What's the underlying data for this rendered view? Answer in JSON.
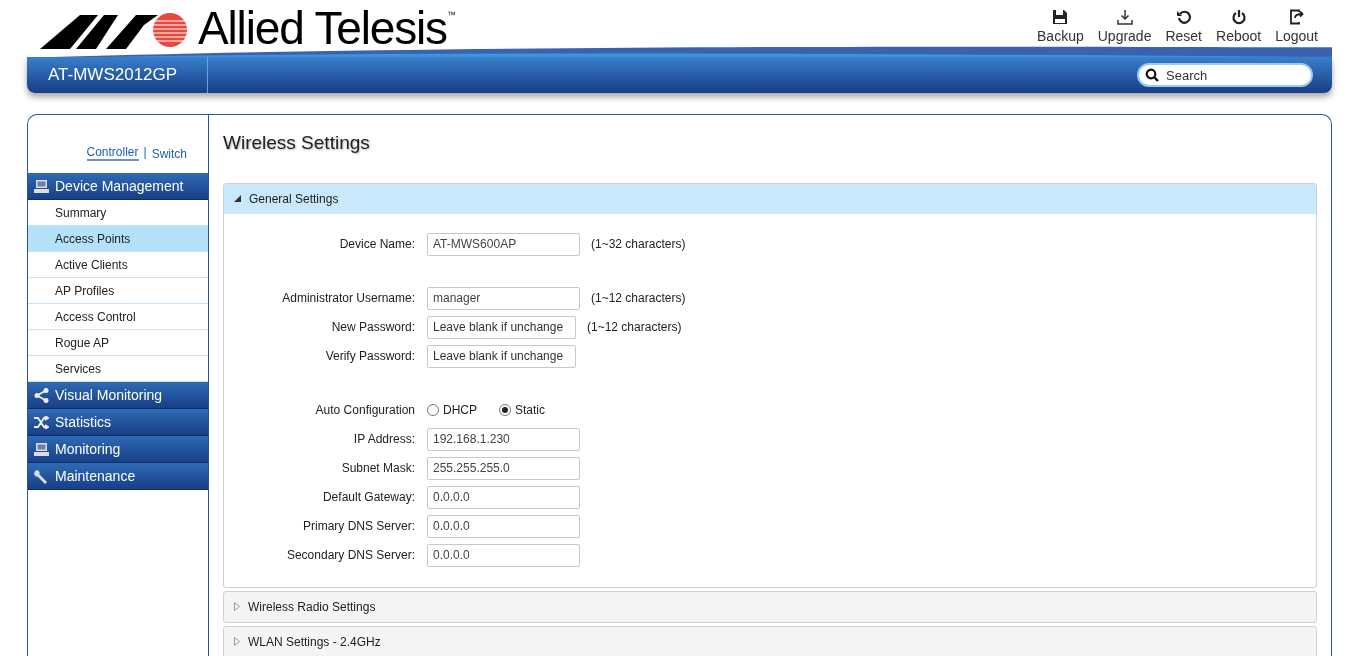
{
  "header": {
    "logo_text": "Allied Telesis",
    "trademark": "™",
    "model": "AT-MWS2012GP",
    "actions": [
      {
        "kind": "backup",
        "label": "Backup"
      },
      {
        "kind": "upgrade",
        "label": "Upgrade"
      },
      {
        "kind": "reset",
        "label": "Reset"
      },
      {
        "kind": "reboot",
        "label": "Reboot"
      },
      {
        "kind": "logout",
        "label": "Logout"
      }
    ],
    "search": {
      "placeholder": "Search"
    }
  },
  "mode_separator": "|",
  "mode_switch": [
    {
      "label": "Controller",
      "selected": true
    },
    {
      "label": "Switch",
      "selected": false
    }
  ],
  "sidebar": {
    "sections": [
      {
        "kind": "device",
        "label": "Device Management",
        "items": [
          {
            "label": "Summary",
            "selected": false
          },
          {
            "label": "Access Points",
            "selected": true
          },
          {
            "label": "Active Clients",
            "selected": false
          },
          {
            "label": "AP Profiles",
            "selected": false
          },
          {
            "label": "Access Control",
            "selected": false
          },
          {
            "label": "Rogue AP",
            "selected": false
          },
          {
            "label": "Services",
            "selected": false
          }
        ]
      },
      {
        "kind": "share",
        "label": "Visual Monitoring"
      },
      {
        "kind": "shuffle",
        "label": "Statistics"
      },
      {
        "kind": "device",
        "label": "Monitoring"
      },
      {
        "kind": "wrench",
        "label": "Maintenance"
      }
    ]
  },
  "page_title": "Wireless Settings",
  "panels": [
    {
      "title": "General Settings",
      "expanded": true,
      "groups": [
        [
          {
            "kind": "text",
            "label": "Device Name:",
            "value": "AT-MWS600AP",
            "hint": "(1~32 characters)"
          }
        ],
        [
          {
            "kind": "text",
            "label": "Administrator Username:",
            "value": "manager",
            "hint": "(1~12 characters)"
          },
          {
            "kind": "password",
            "label": "New Password:",
            "placeholder": "Leave blank if unchange",
            "hint": "(1~12 characters)"
          },
          {
            "kind": "password",
            "label": "Verify Password:",
            "placeholder": "Leave blank if unchange"
          }
        ],
        [
          {
            "kind": "radio",
            "label": "Auto Configuration",
            "options": [
              {
                "label": "DHCP",
                "selected": false
              },
              {
                "label": "Static",
                "selected": true
              }
            ]
          },
          {
            "kind": "text",
            "label": "IP Address:",
            "value": "192.168.1.230"
          },
          {
            "kind": "text",
            "label": "Subnet Mask:",
            "value": "255.255.255.0"
          },
          {
            "kind": "text",
            "label": "Default Gateway:",
            "value": "0.0.0.0"
          },
          {
            "kind": "text",
            "label": "Primary DNS Server:",
            "value": "0.0.0.0"
          },
          {
            "kind": "text",
            "label": "Secondary DNS Server:",
            "value": "0.0.0.0"
          }
        ]
      ]
    },
    {
      "title": "Wireless Radio Settings",
      "expanded": false
    },
    {
      "title": "WLAN Settings - 2.4GHz",
      "expanded": false
    }
  ]
}
